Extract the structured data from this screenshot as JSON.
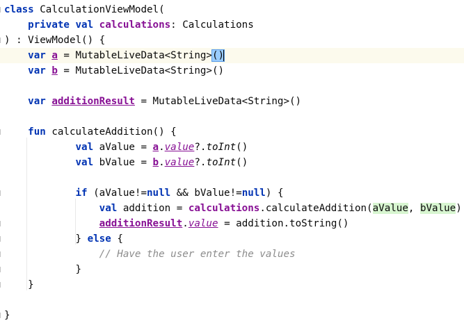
{
  "editor": {
    "lines": [
      {
        "parts": [
          [
            "kw",
            "class "
          ],
          [
            "",
            "CalculationViewModel("
          ]
        ]
      },
      {
        "parts": [
          [
            "",
            "    "
          ],
          [
            "kw",
            "private val "
          ],
          [
            "prop",
            "calculations"
          ],
          [
            "",
            ": Calculations"
          ]
        ]
      },
      {
        "parts": [
          [
            "",
            ") : ViewModel() {"
          ]
        ]
      },
      {
        "parts": [
          [
            "",
            "    "
          ],
          [
            "kw",
            "var "
          ],
          [
            "var-under",
            "a"
          ],
          [
            "",
            " = MutableLiveData<String>"
          ],
          [
            "brace-hl",
            "()"
          ],
          [
            "caret",
            ""
          ]
        ],
        "caret_line": true
      },
      {
        "parts": [
          [
            "",
            "    "
          ],
          [
            "kw",
            "var "
          ],
          [
            "var-under",
            "b"
          ],
          [
            "",
            " = MutableLiveData<String>()"
          ]
        ]
      },
      {
        "parts": [
          [
            "",
            ""
          ]
        ]
      },
      {
        "parts": [
          [
            "",
            "    "
          ],
          [
            "kw",
            "var "
          ],
          [
            "var-under",
            "additionResult"
          ],
          [
            "",
            " = MutableLiveData<String>()"
          ]
        ]
      },
      {
        "parts": [
          [
            "",
            ""
          ]
        ]
      },
      {
        "parts": [
          [
            "",
            "    "
          ],
          [
            "kw",
            "fun "
          ],
          [
            "",
            "calculateAddition() {"
          ]
        ]
      },
      {
        "parts": [
          [
            "",
            "            "
          ],
          [
            "kw",
            "val "
          ],
          [
            "",
            "aValue = "
          ],
          [
            "var-under",
            "a"
          ],
          [
            "",
            "."
          ],
          [
            "ext",
            "value"
          ],
          [
            "",
            "?."
          ],
          [
            "fn-italic",
            "toInt"
          ],
          [
            "",
            "()"
          ]
        ]
      },
      {
        "parts": [
          [
            "",
            "            "
          ],
          [
            "kw",
            "val "
          ],
          [
            "",
            "bValue = "
          ],
          [
            "var-under",
            "b"
          ],
          [
            "",
            "."
          ],
          [
            "ext",
            "value"
          ],
          [
            "",
            "?."
          ],
          [
            "fn-italic",
            "toInt"
          ],
          [
            "",
            "()"
          ]
        ]
      },
      {
        "parts": [
          [
            "",
            ""
          ]
        ]
      },
      {
        "parts": [
          [
            "",
            "            "
          ],
          [
            "kw",
            "if "
          ],
          [
            "",
            "(aValue!="
          ],
          [
            "kw",
            "null "
          ],
          [
            "",
            "&& bValue!="
          ],
          [
            "kw",
            "null"
          ],
          [
            "",
            ") {"
          ]
        ]
      },
      {
        "parts": [
          [
            "",
            "                "
          ],
          [
            "kw",
            "val "
          ],
          [
            "",
            "addition = "
          ],
          [
            "prop",
            "calculations"
          ],
          [
            "",
            ".calculateAddition("
          ],
          [
            "hl",
            "aValue"
          ],
          [
            "",
            ", "
          ],
          [
            "hl",
            "bValue"
          ],
          [
            "",
            ")"
          ]
        ]
      },
      {
        "parts": [
          [
            "",
            "                "
          ],
          [
            "var-under",
            "additionResult"
          ],
          [
            "",
            "."
          ],
          [
            "ext",
            "value"
          ],
          [
            "",
            " = addition.toString()"
          ]
        ]
      },
      {
        "parts": [
          [
            "",
            "            } "
          ],
          [
            "kw",
            "else "
          ],
          [
            "",
            "{"
          ]
        ]
      },
      {
        "parts": [
          [
            "",
            "                "
          ],
          [
            "cmt",
            "// Have the user enter the values"
          ]
        ]
      },
      {
        "parts": [
          [
            "",
            "            }"
          ]
        ]
      },
      {
        "parts": [
          [
            "",
            "    }"
          ]
        ]
      },
      {
        "parts": [
          [
            "",
            ""
          ]
        ]
      },
      {
        "parts": [
          [
            "",
            "}"
          ]
        ]
      }
    ]
  }
}
